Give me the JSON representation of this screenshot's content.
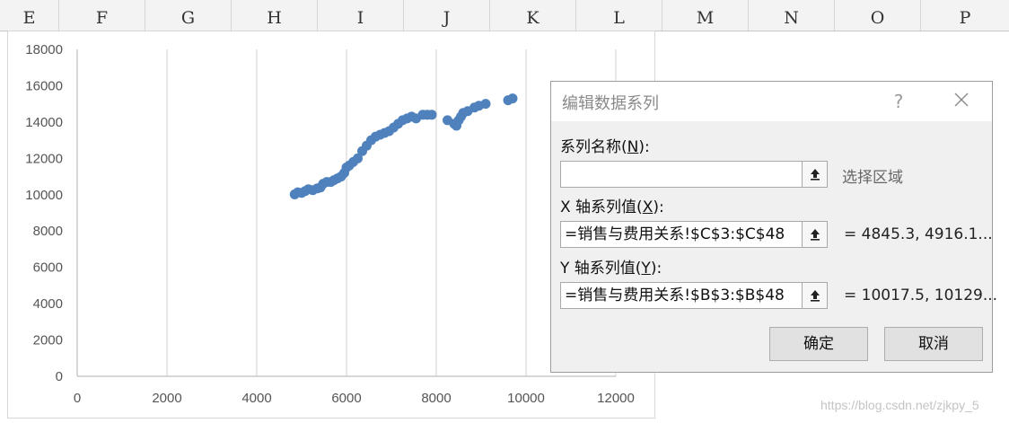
{
  "columns": [
    "E",
    "F",
    "G",
    "H",
    "I",
    "J",
    "K",
    "L",
    "M",
    "N",
    "O",
    "P"
  ],
  "chart_data": {
    "type": "scatter",
    "xlim": [
      0,
      12000
    ],
    "ylim": [
      0,
      18000
    ],
    "x_ticks": [
      0,
      2000,
      4000,
      6000,
      8000,
      10000,
      12000
    ],
    "y_ticks": [
      0,
      2000,
      4000,
      6000,
      8000,
      10000,
      12000,
      14000,
      16000,
      18000
    ],
    "gridlines": "vertical",
    "marker_color": "#4f81bd",
    "series": [
      {
        "x": [
          4845.3,
          4916.1,
          5000,
          5080,
          5150,
          5250,
          5350,
          5420,
          5480,
          5560,
          5650,
          5720,
          5800,
          5880,
          5950,
          6000,
          6060,
          6150,
          6250,
          6350,
          6450,
          6550,
          6650,
          6750,
          6850,
          6950,
          7050,
          7150,
          7250,
          7350,
          7450,
          7550,
          7700,
          7800,
          7900,
          8250,
          8400,
          8450,
          8500,
          8550,
          8600,
          8700,
          8850,
          8950,
          9100,
          9600,
          9700
        ],
        "y": [
          10017.5,
          10129,
          10100,
          10200,
          10300,
          10250,
          10350,
          10400,
          10600,
          10700,
          10700,
          10800,
          10900,
          11000,
          11200,
          11500,
          11600,
          11800,
          12000,
          12400,
          12700,
          13000,
          13200,
          13300,
          13400,
          13500,
          13700,
          13900,
          14100,
          14200,
          14300,
          14200,
          14400,
          14400,
          14400,
          14100,
          13900,
          13800,
          14100,
          14300,
          14500,
          14600,
          14800,
          14900,
          15000,
          15200,
          15300
        ]
      }
    ]
  },
  "dialog": {
    "title": "编辑数据系列",
    "help": "?",
    "close": "✕",
    "name_label_pre": "系列名称(",
    "name_label_key": "N",
    "name_label_post": "):",
    "name_value": "",
    "select_range": "选择区域",
    "x_label_pre": "X 轴系列值(",
    "x_label_key": "X",
    "x_label_post": "):",
    "x_value": "=销售与费用关系!$C$3:$C$48",
    "x_preview": "= 4845.3, 4916.1...",
    "y_label_pre": "Y 轴系列值(",
    "y_label_key": "Y",
    "y_label_post": "):",
    "y_value": "=销售与费用关系!$B$3:$B$48",
    "y_preview": "= 10017.5, 10129...",
    "ok": "确定",
    "cancel": "取消"
  },
  "watermark": "https://blog.csdn.net/zjkpy_5"
}
